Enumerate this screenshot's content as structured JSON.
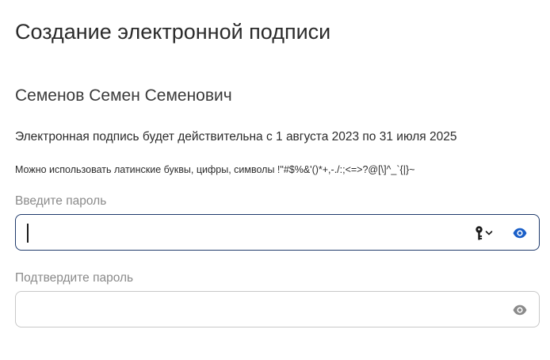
{
  "page": {
    "title": "Создание электронной подписи"
  },
  "signer": {
    "name": "Семенов Семен Семенович"
  },
  "validity": {
    "text": "Электронная подпись будет действительна с 1 августа 2023 по 31 июля 2025"
  },
  "hint": {
    "text": "Можно использовать латинские буквы, цифры, символы !\"#$%&'()*+,-./:;<=>?@[\\]^_`{|}~"
  },
  "password_field": {
    "label": "Введите пароль",
    "value": "",
    "placeholder": "",
    "icons": [
      "key-icon",
      "chevron-down-icon",
      "eye-icon"
    ],
    "eye_color": "#1a5fc8",
    "border_color": "#1f3a6b"
  },
  "confirm_field": {
    "label": "Подтвердите пароль",
    "value": "",
    "placeholder": "",
    "icons": [
      "eye-icon"
    ],
    "eye_color": "#8a8a8a",
    "border_color": "#c8c8c8"
  }
}
